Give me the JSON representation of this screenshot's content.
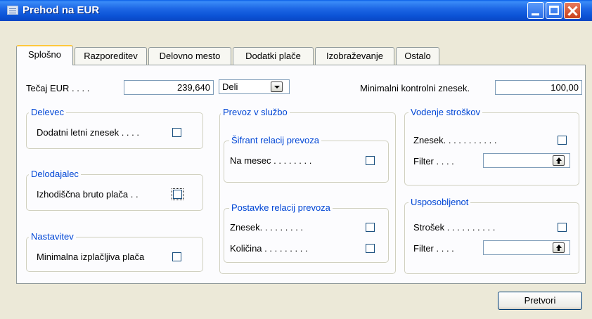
{
  "window": {
    "title": "Prehod na EUR"
  },
  "tabs": [
    {
      "label": "Splošno",
      "active": true
    },
    {
      "label": "Razporeditev"
    },
    {
      "label": "Delovno mesto"
    },
    {
      "label": "Dodatki plače"
    },
    {
      "label": "Izobraževanje"
    },
    {
      "label": "Ostalo"
    }
  ],
  "top": {
    "tecaj_label": "Tečaj EUR",
    "tecaj_dots": ". . . .",
    "tecaj_value": "239,640",
    "operation_value": "Deli",
    "min_label": "Minimalni kontrolni znesek.",
    "min_value": "100,00"
  },
  "groups": {
    "delevec": {
      "title": "Delevec",
      "field": "Dodatni letni znesek",
      "dots": ". . . ."
    },
    "delodajalec": {
      "title": "Delodajalec",
      "field": "Izhodiščna bruto plača",
      "dots": ". ."
    },
    "nastavitev": {
      "title": "Nastavitev",
      "field": "Minimalna izplačljiva plača"
    },
    "prevoz": {
      "title": "Prevoz v službo"
    },
    "sifrant": {
      "title": "Šifrant relacij prevoza",
      "field": "Na mesec",
      "dots": ". . . . . . . ."
    },
    "postavke": {
      "title": "Postavke relacij prevoza",
      "field1": "Znesek",
      "dots1": ". . . . . . . . .",
      "field2": "Količina",
      "dots2": ". . . . . . . . ."
    },
    "vodenje": {
      "title": "Vodenje stroškov",
      "field1": "Znesek",
      "dots1": ". . . . . . . . . . .",
      "field2": "Filter",
      "dots2": ". . . .",
      "filter_value": ""
    },
    "usposobljenost": {
      "title": "Usposobljenot",
      "field1": "Strošek",
      "dots1": ". . . . . . . . . .",
      "field2": "Filter",
      "dots2": ". . . .",
      "filter_value": ""
    }
  },
  "buttons": {
    "pretvori": "Pretvori"
  }
}
